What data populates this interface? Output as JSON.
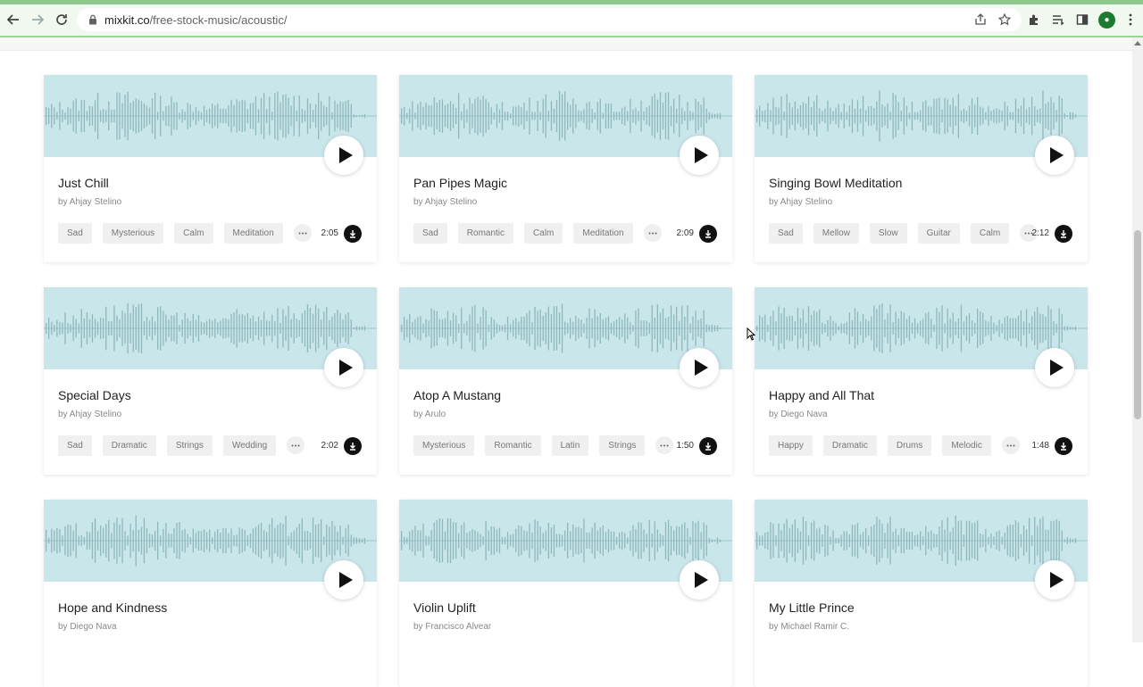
{
  "browser": {
    "url_host": "mixkit.co",
    "url_path": "/free-stock-music/acoustic/",
    "icons": [
      "back-arrow-icon",
      "forward-arrow-icon",
      "reload-icon",
      "lock-icon",
      "share-icon",
      "star-icon",
      "extensions-icon",
      "reading-list-icon",
      "side-panel-icon",
      "profile-avatar",
      "menu-icon"
    ]
  },
  "colors": {
    "waveform_bg": "#c9e6ea",
    "waveform_bar": "#8fb8bd",
    "accent": "#111111"
  },
  "tracks": [
    {
      "title": "Just Chill",
      "author": "by Ahjay Stelino",
      "tags": [
        "Sad",
        "Mysterious",
        "Calm",
        "Meditation"
      ],
      "duration": "2:05"
    },
    {
      "title": "Pan Pipes Magic",
      "author": "by Ahjay Stelino",
      "tags": [
        "Sad",
        "Romantic",
        "Calm",
        "Meditation"
      ],
      "duration": "2:09"
    },
    {
      "title": "Singing Bowl Meditation",
      "author": "by Ahjay Stelino",
      "tags": [
        "Sad",
        "Mellow",
        "Slow",
        "Guitar",
        "Calm"
      ],
      "duration": "2:12"
    },
    {
      "title": "Special Days",
      "author": "by Ahjay Stelino",
      "tags": [
        "Sad",
        "Dramatic",
        "Strings",
        "Wedding"
      ],
      "duration": "2:02"
    },
    {
      "title": "Atop A Mustang",
      "author": "by Arulo",
      "tags": [
        "Mysterious",
        "Romantic",
        "Latin",
        "Strings"
      ],
      "duration": "1:50"
    },
    {
      "title": "Happy and All That",
      "author": "by Diego Nava",
      "tags": [
        "Happy",
        "Dramatic",
        "Drums",
        "Melodic"
      ],
      "duration": "1:48"
    },
    {
      "title": "Hope and Kindness",
      "author": "by Diego Nava",
      "tags": [],
      "duration": ""
    },
    {
      "title": "Violin Uplift",
      "author": "by Francisco Alvear",
      "tags": [],
      "duration": ""
    },
    {
      "title": "My Little Prince",
      "author": "by Michael Ramir C.",
      "tags": [],
      "duration": ""
    }
  ]
}
